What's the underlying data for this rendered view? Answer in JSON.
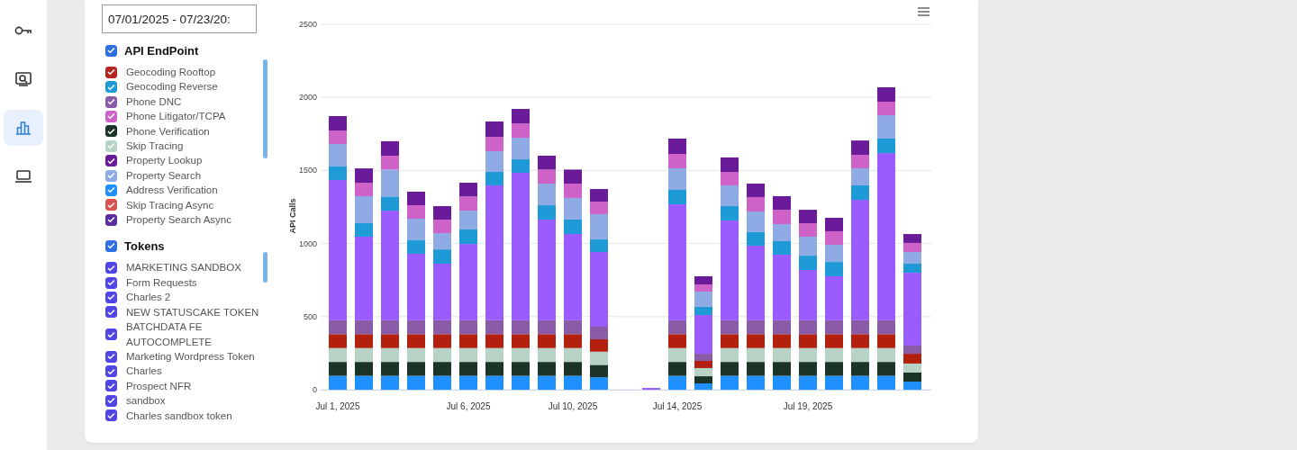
{
  "nav": [
    {
      "selected": false
    },
    {
      "selected": false
    },
    {
      "selected": true
    },
    {
      "selected": false
    }
  ],
  "filters": {
    "date_range": "07/01/2025 - 07/23/20:",
    "groups": [
      {
        "title": "API EndPoint",
        "checked": true,
        "items": [
          {
            "label": "Geocoding Rooftop",
            "checked": true,
            "color": "#b3261e"
          },
          {
            "label": "Geocoding Reverse",
            "checked": true,
            "color": "#1e9bd7"
          },
          {
            "label": "Phone DNC",
            "checked": true,
            "color": "#8a5ca8"
          },
          {
            "label": "Phone Litigator/TCPA",
            "checked": true,
            "color": "#cf62c9"
          },
          {
            "label": "Phone Verification",
            "checked": true,
            "color": "#1c3328"
          },
          {
            "label": "Skip Tracing",
            "checked": true,
            "color": "#b7d3c5"
          },
          {
            "label": "Property Lookup",
            "checked": true,
            "color": "#6a1b9a"
          },
          {
            "label": "Property Search",
            "checked": true,
            "color": "#8fabe6"
          },
          {
            "label": "Address Verification",
            "checked": true,
            "color": "#1e90ff"
          },
          {
            "label": "Skip Tracing Async",
            "checked": true,
            "color": "#d9534f"
          },
          {
            "label": "Property Search Async",
            "checked": true,
            "color": "#5b2fa0"
          }
        ]
      },
      {
        "title": "Tokens",
        "checked": true,
        "items": [
          {
            "label": "MARKETING SANDBOX",
            "checked": true
          },
          {
            "label": "Form Requests",
            "checked": true
          },
          {
            "label": "Charles 2",
            "checked": true
          },
          {
            "label": "NEW STATUSCAKE TOKEN",
            "checked": true
          },
          {
            "label": "BATCHDATA FE AUTOCOMPLETE",
            "checked": true
          },
          {
            "label": "Marketing Wordpress Token",
            "checked": true
          },
          {
            "label": "Charles",
            "checked": true
          },
          {
            "label": "Prospect NFR",
            "checked": true
          },
          {
            "label": "sandbox",
            "checked": true
          },
          {
            "label": "Charles sandbox token",
            "checked": true
          }
        ]
      }
    ]
  },
  "chart": {
    "chart_data": {
      "type": "bar",
      "stacked": true,
      "grid": true,
      "ylabel": "API Calls",
      "ylim": [
        0,
        2500
      ],
      "yticks": [
        0,
        500,
        1000,
        1500,
        2000,
        2500
      ],
      "categories": [
        "Jul 1, 2025",
        null,
        null,
        null,
        null,
        "Jul 6, 2025",
        null,
        null,
        null,
        "Jul 10, 2025",
        null,
        null,
        null,
        "Jul 14, 2025",
        null,
        null,
        null,
        null,
        "Jul 19, 2025",
        null,
        null,
        null,
        null
      ],
      "series": [
        {
          "color": "#1e90ff",
          "values": [
            95,
            95,
            95,
            95,
            95,
            95,
            95,
            95,
            95,
            95,
            85,
            null,
            0,
            95,
            43,
            95,
            95,
            95,
            95,
            95,
            95,
            95,
            55
          ]
        },
        {
          "color": "#1c3328",
          "values": [
            95,
            95,
            95,
            95,
            95,
            95,
            95,
            95,
            95,
            95,
            85,
            null,
            0,
            95,
            49,
            95,
            95,
            95,
            95,
            95,
            95,
            95,
            62
          ]
        },
        {
          "color": "#b7d3c5",
          "values": [
            95,
            95,
            95,
            95,
            95,
            95,
            95,
            95,
            95,
            95,
            90,
            null,
            0,
            95,
            56,
            95,
            95,
            95,
            95,
            95,
            95,
            95,
            62
          ]
        },
        {
          "color": "#b3200e",
          "values": [
            95,
            95,
            95,
            95,
            95,
            95,
            95,
            95,
            95,
            95,
            85,
            null,
            0,
            95,
            49,
            95,
            95,
            95,
            95,
            95,
            95,
            95,
            67
          ]
        },
        {
          "color": "#8a5ca8",
          "values": [
            95,
            95,
            95,
            95,
            95,
            95,
            95,
            95,
            95,
            95,
            86,
            null,
            0,
            95,
            49,
            95,
            95,
            95,
            95,
            95,
            95,
            95,
            56
          ]
        },
        {
          "color": "#9b5cff",
          "values": [
            960,
            572,
            750,
            455,
            387,
            522,
            923,
            1009,
            689,
            590,
            511,
            null,
            12,
            793,
            265,
            683,
            510,
            449,
            344,
            301,
            824,
            1144,
            498
          ]
        },
        {
          "color": "#1e9bd7",
          "values": [
            92,
            92,
            97,
            92,
            98,
            99,
            92,
            92,
            98,
            99,
            86,
            null,
            0,
            99,
            56,
            98,
            93,
            92,
            98,
            98,
            99,
            99,
            62
          ]
        },
        {
          "color": "#8fabe6",
          "values": [
            154,
            185,
            184,
            148,
            111,
            129,
            142,
            148,
            148,
            148,
            173,
            null,
            0,
            148,
            104,
            142,
            141,
            117,
            130,
            117,
            117,
            160,
            80
          ]
        },
        {
          "color": "#cf62c9",
          "values": [
            92,
            92,
            95,
            92,
            93,
            97,
            98,
            98,
            96,
            98,
            86,
            null,
            0,
            98,
            49,
            92,
            99,
            98,
            92,
            93,
            92,
            92,
            62
          ]
        },
        {
          "color": "#6a1b9a",
          "values": [
            99,
            98,
            99,
            93,
            92,
            94,
            105,
            99,
            95,
            96,
            86,
            null,
            0,
            105,
            56,
            99,
            92,
            93,
            92,
            92,
            98,
            99,
            61
          ]
        }
      ]
    }
  }
}
